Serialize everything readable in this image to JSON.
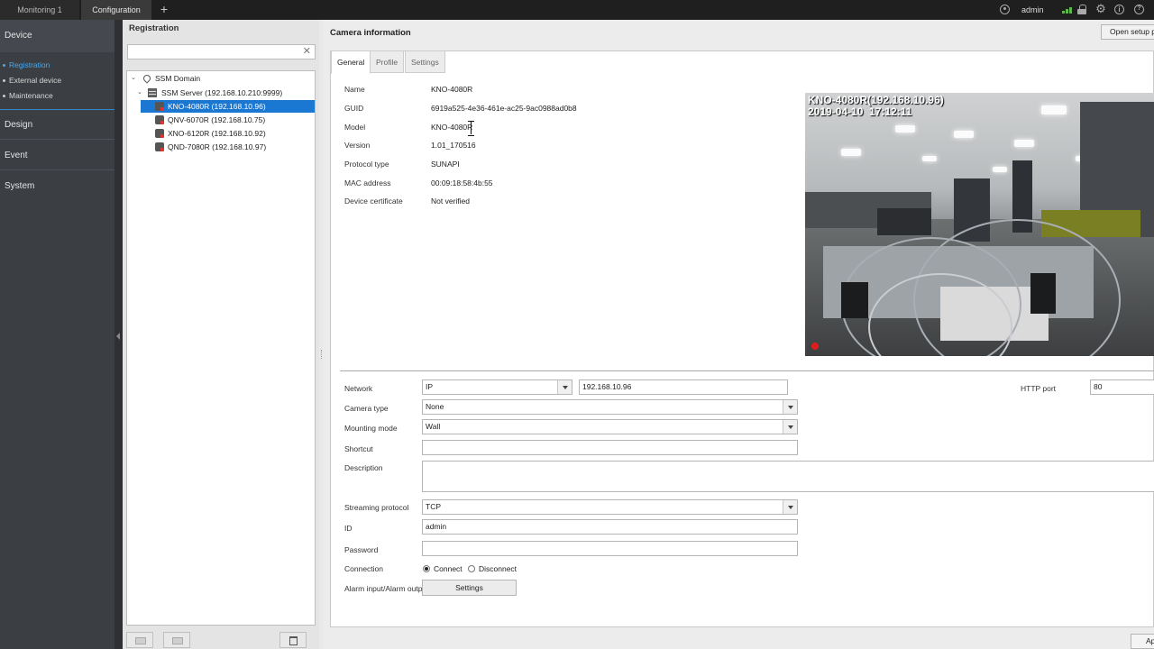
{
  "topbar": {
    "tabs": [
      "Monitoring 1",
      "Configuration"
    ],
    "add_tab": "+",
    "user": "admin"
  },
  "leftnav": {
    "device": "Device",
    "device_items": [
      "Registration",
      "External device",
      "Maintenance"
    ],
    "design": "Design",
    "event": "Event",
    "system": "System"
  },
  "registration": {
    "title": "Registration",
    "search_value": "",
    "clear": "✕",
    "tree": {
      "domain": "SSM Domain",
      "server": "SSM Server (192.168.10.210:9999)",
      "cameras": [
        "KNO-4080R (192.168.10.96)",
        "QNV-6070R (192.168.10.75)",
        "XNO-6120R (192.168.10.92)",
        "QND-7080R (192.168.10.97)"
      ]
    }
  },
  "camera": {
    "title": "Camera information",
    "open_setup": "Open setup page",
    "tabs": [
      "General",
      "Profile",
      "Settings"
    ],
    "info_labels": [
      "Name",
      "GUID",
      "Model",
      "Version",
      "Protocol type",
      "MAC address",
      "Device certificate"
    ],
    "info_values": [
      "KNO-4080R",
      "6919a525-4e36-461e-ac25-9ac0988ad0b8",
      "KNO-4080R",
      "1.01_170516",
      "SUNAPI",
      "00:09:18:58:4b:55",
      "Not verified"
    ],
    "preview_overlay": "KNO-4080R(192.168.10.96)\n2019-04-10  17:12:11",
    "form": {
      "network_label": "Network",
      "network_type": "IP",
      "ip_address": "192.168.10.96",
      "http_port_label": "HTTP port",
      "http_port": "80",
      "camera_type_label": "Camera type",
      "camera_type": "None",
      "mounting_mode_label": "Mounting mode",
      "mounting_mode": "Wall",
      "shortcut_label": "Shortcut",
      "shortcut": "",
      "description_label": "Description",
      "description": "",
      "streaming_protocol_label": "Streaming protocol",
      "streaming_protocol": "TCP",
      "id_label": "ID",
      "id": "admin",
      "password_label": "Password",
      "password": "",
      "connection_label": "Connection",
      "connect": "Connect",
      "disconnect": "Disconnect",
      "connection_selected": "Connect",
      "alarm_label": "Alarm input/Alarm output",
      "settings_button": "Settings"
    },
    "apply_button": "Apply"
  }
}
